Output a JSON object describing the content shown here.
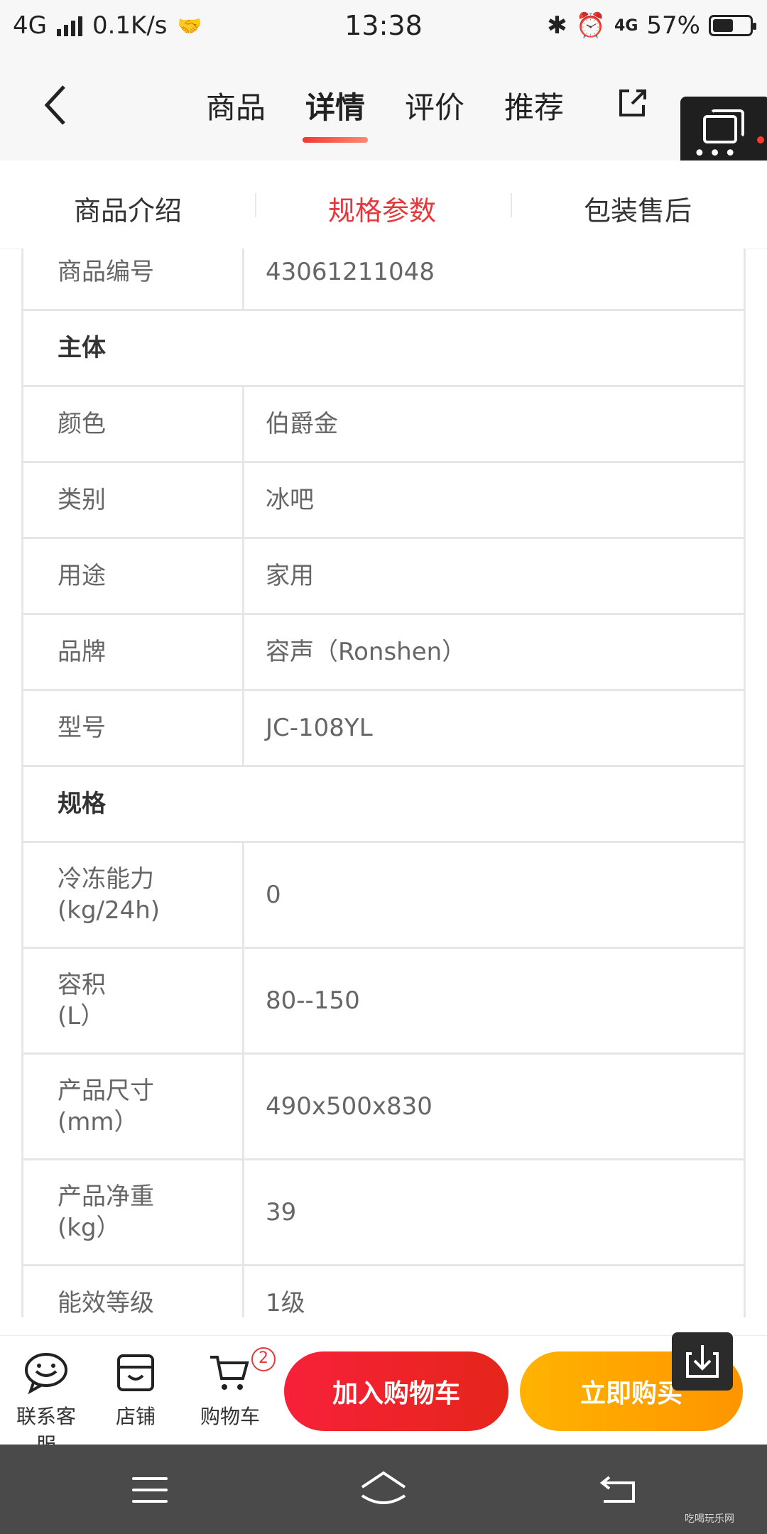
{
  "status": {
    "network": "4G",
    "speed": "0.1K/s",
    "time": "13:38",
    "net2": "4G",
    "battery_pct": "57%",
    "battery_level": 0.57
  },
  "header": {
    "tabs": [
      "商品",
      "详情",
      "评价",
      "推荐"
    ],
    "active_tab": "详情"
  },
  "subtabs": {
    "items": [
      "商品介绍",
      "规格参数",
      "包装售后"
    ],
    "active": "规格参数"
  },
  "specs": [
    {
      "type": "row",
      "key": "商品编号",
      "value": "43061211048"
    },
    {
      "type": "group",
      "label": "主体"
    },
    {
      "type": "row",
      "key": "颜色",
      "value": "伯爵金"
    },
    {
      "type": "row",
      "key": "类别",
      "value": "冰吧"
    },
    {
      "type": "row",
      "key": "用途",
      "value": "家用"
    },
    {
      "type": "row",
      "key": "品牌",
      "value": "容声（Ronshen）"
    },
    {
      "type": "row",
      "key": "型号",
      "value": "JC-108YL"
    },
    {
      "type": "group",
      "label": "规格"
    },
    {
      "type": "row2",
      "key1": "冷冻能力",
      "key2": "(kg/24h)",
      "value": "0"
    },
    {
      "type": "row2",
      "key1": "容积",
      "key2": "(L）",
      "value": "80--150"
    },
    {
      "type": "row2",
      "key1": "产品尺寸",
      "key2": "(mm）",
      "value": "490x500x830"
    },
    {
      "type": "row2",
      "key1": "产品净重",
      "key2": "(kg）",
      "value": "39"
    },
    {
      "type": "row",
      "key": "能效等级",
      "value": "1级"
    }
  ],
  "actionbar": {
    "service": "联系客服",
    "store": "店铺",
    "cart": "购物车",
    "cart_count": "2",
    "add_to_cart": "加入购物车",
    "buy_now": "立即购买"
  },
  "watermark": "吃喝玩乐网"
}
